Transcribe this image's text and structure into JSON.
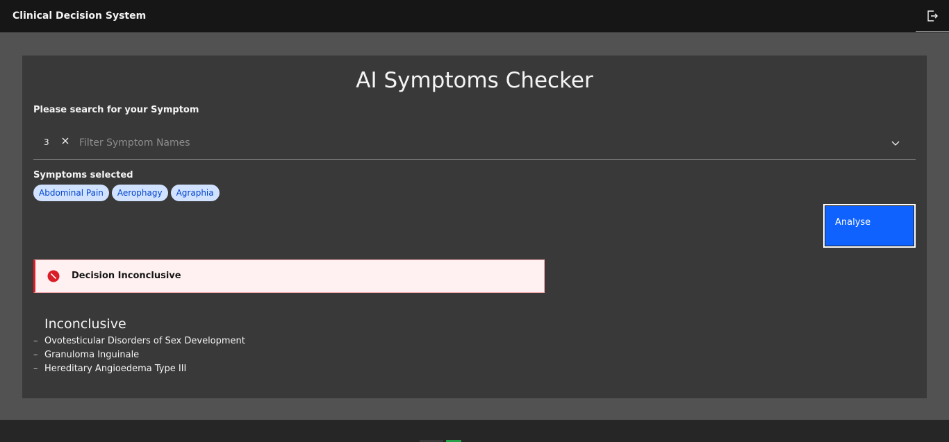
{
  "header": {
    "app_title": "Clinical Decision System",
    "logout_icon": "logout-icon"
  },
  "main": {
    "title": "AI Symptoms Checker",
    "search_label": "Please search for your Symptom",
    "combobox": {
      "selected_count": "3",
      "placeholder": "Filter Symptom Names",
      "value": ""
    },
    "selected_label": "Symptoms selected",
    "tags": [
      "Abdominal Pain",
      "Aerophagy",
      "Agraphia"
    ],
    "analyse_label": "Analyse"
  },
  "notification": {
    "kind": "error",
    "icon": "error-filled-icon",
    "title": "Decision Inconclusive",
    "accent_color": "#da1e28"
  },
  "result": {
    "heading": "Inconclusive",
    "items": [
      "Ovotesticular Disorders of Sex Development",
      "Granuloma Inguinale",
      "Hereditary Angioedema Type III"
    ]
  },
  "colors": {
    "primary_button": "#0f62fe",
    "tag_bg": "#d0e2ff",
    "tag_text": "#0043ce"
  }
}
